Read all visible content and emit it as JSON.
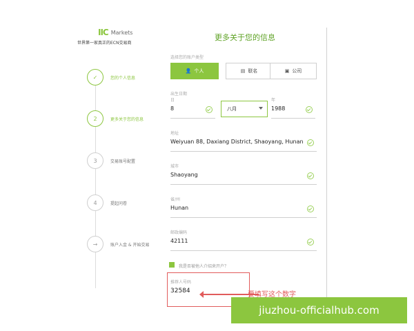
{
  "brand": {
    "logo_mark": "IIC",
    "logo_text": "Markets",
    "tagline": "世界第一家真正的ECN交易商"
  },
  "steps": [
    {
      "num": "✓",
      "label": "您的个人信息",
      "active": true
    },
    {
      "num": "2",
      "label": "更多关于您的信息",
      "active": true
    },
    {
      "num": "3",
      "label": "交易账号配置",
      "active": false
    },
    {
      "num": "4",
      "label": "提起问卷",
      "active": false
    },
    {
      "num": "→",
      "label": "账户入金 & 开始交易",
      "active": false
    }
  ],
  "form": {
    "title": "更多关于您的信息",
    "account_type_label": "选择您的账户类型",
    "account_types": [
      {
        "label": "个人",
        "selected": true,
        "icon": "user-icon"
      },
      {
        "label": "联名",
        "selected": false,
        "icon": "id-card-icon"
      },
      {
        "label": "公司",
        "selected": false,
        "icon": "briefcase-icon"
      }
    ],
    "dob_label": "出生日期",
    "day_label": "日",
    "day_value": "8",
    "month_value": "八月",
    "year_label": "年",
    "year_value": "1988",
    "address_label": "地址",
    "address_value": "Weiyuan 88, Daxiang District, Shaoyang, Hunan",
    "city_label": "城市",
    "city_value": "Shaoyang",
    "province_label": "省/州",
    "province_value": "Hunan",
    "zip_label": "邮政编码",
    "zip_value": "42111",
    "referral_text": "我是否被他人介绍来开户？",
    "referral_id_label": "推荐人号码",
    "referral_id_value": "32584"
  },
  "annotation": "要填写这个数字",
  "watermark": "jiuzhou-officialhub.com",
  "colors": {
    "accent": "#8cc63f",
    "annotation": "#e15b5b"
  }
}
